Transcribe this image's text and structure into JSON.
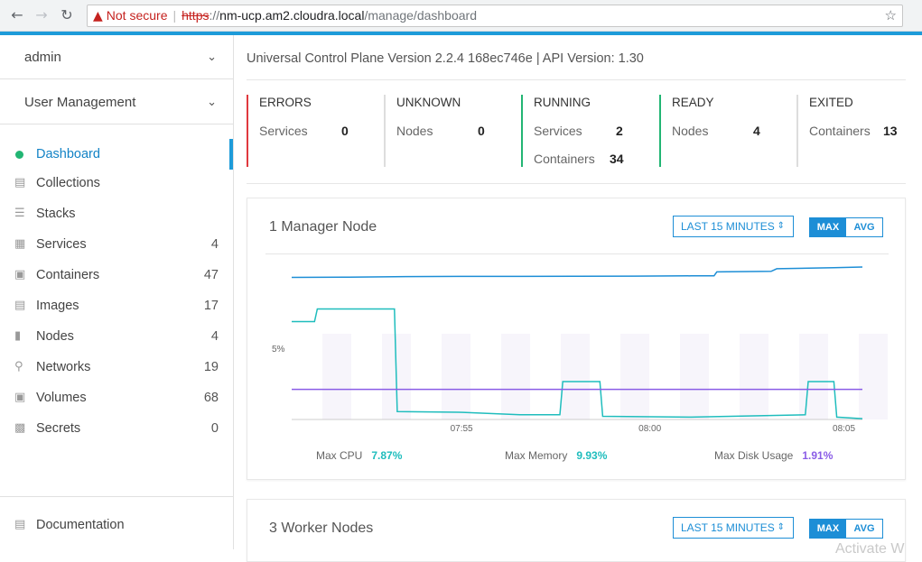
{
  "browser": {
    "warning_icon": "warning-triangle-icon",
    "security_label": "Not secure",
    "url_scheme": "https",
    "url_host": "nm-ucp.am2.cloudra.local",
    "url_path": "/manage/dashboard"
  },
  "sidebar": {
    "user": "admin",
    "section": "User Management",
    "items": [
      {
        "label": "Dashboard",
        "count": "",
        "icon": "status-dot-icon"
      },
      {
        "label": "Collections",
        "count": "",
        "icon": "collections-icon"
      },
      {
        "label": "Stacks",
        "count": "",
        "icon": "stacks-icon"
      },
      {
        "label": "Services",
        "count": "4",
        "icon": "services-icon"
      },
      {
        "label": "Containers",
        "count": "47",
        "icon": "container-icon"
      },
      {
        "label": "Images",
        "count": "17",
        "icon": "image-icon"
      },
      {
        "label": "Nodes",
        "count": "4",
        "icon": "node-icon"
      },
      {
        "label": "Networks",
        "count": "19",
        "icon": "network-icon"
      },
      {
        "label": "Volumes",
        "count": "68",
        "icon": "volume-icon"
      },
      {
        "label": "Secrets",
        "count": "0",
        "icon": "lock-icon"
      }
    ],
    "documentation": "Documentation"
  },
  "header": {
    "version_text": "Universal Control Plane Version 2.2.4 168ec746e | API Version: 1.30"
  },
  "stats": {
    "errors": {
      "title": "ERRORS",
      "rows": [
        {
          "label": "Services",
          "value": "0"
        }
      ],
      "color": "#e0393e"
    },
    "unknown": {
      "title": "UNKNOWN",
      "rows": [
        {
          "label": "Nodes",
          "value": "0"
        }
      ],
      "color": "#dddddd"
    },
    "running": {
      "title": "RUNNING",
      "rows": [
        {
          "label": "Services",
          "value": "2"
        },
        {
          "label": "Containers",
          "value": "34"
        }
      ],
      "color": "#22b573"
    },
    "ready": {
      "title": "READY",
      "rows": [
        {
          "label": "Nodes",
          "value": "4"
        }
      ],
      "color": "#22b573"
    },
    "exited": {
      "title": "EXITED",
      "rows": [
        {
          "label": "Containers",
          "value": "13"
        }
      ],
      "color": "#dddddd"
    }
  },
  "manager_panel": {
    "title": "1 Manager Node",
    "range": "LAST 15 MINUTES",
    "max": "MAX",
    "avg": "AVG",
    "legend": [
      {
        "label": "Max CPU",
        "value": "7.87%",
        "color": "#1fbdbd"
      },
      {
        "label": "Max Memory",
        "value": "9.93%",
        "color": "#1fbdbd"
      },
      {
        "label": "Max Disk Usage",
        "value": "1.91%",
        "color": "#8a5ce6"
      }
    ]
  },
  "worker_panel": {
    "title": "3 Worker Nodes",
    "range": "LAST 15 MINUTES",
    "max": "MAX",
    "avg": "AVG"
  },
  "watermark": "Activate W",
  "chart_data": {
    "type": "line",
    "y_tick_label": "5%",
    "x_tick_labels": [
      "07:55",
      "08:00",
      "08:05"
    ],
    "series": [
      {
        "name": "Max Memory",
        "color": "#1d8ed6",
        "points": [
          [
            0,
            9.0
          ],
          [
            0.1,
            9.02
          ],
          [
            0.2,
            9.05
          ],
          [
            0.3,
            9.06
          ],
          [
            0.4,
            9.06
          ],
          [
            0.5,
            9.07
          ],
          [
            0.6,
            9.08
          ],
          [
            0.7,
            9.1
          ],
          [
            0.74,
            9.1
          ],
          [
            0.745,
            9.35
          ],
          [
            0.84,
            9.38
          ],
          [
            0.85,
            9.55
          ],
          [
            0.95,
            9.62
          ],
          [
            1.0,
            9.66
          ]
        ]
      },
      {
        "name": "Max CPU",
        "color": "#1fbdbd",
        "points": [
          [
            0,
            6.2
          ],
          [
            0.04,
            6.2
          ],
          [
            0.045,
            7.0
          ],
          [
            0.18,
            7.0
          ],
          [
            0.185,
            0.5
          ],
          [
            0.3,
            0.45
          ],
          [
            0.4,
            0.3
          ],
          [
            0.47,
            0.3
          ],
          [
            0.475,
            2.4
          ],
          [
            0.54,
            2.4
          ],
          [
            0.545,
            0.2
          ],
          [
            0.7,
            0.15
          ],
          [
            0.9,
            0.3
          ],
          [
            0.905,
            2.4
          ],
          [
            0.95,
            2.4
          ],
          [
            0.955,
            0.15
          ],
          [
            1.0,
            0.05
          ]
        ]
      },
      {
        "name": "Max Disk Usage",
        "color": "#8a5ce6",
        "points": [
          [
            0,
            1.91
          ],
          [
            1.0,
            1.91
          ]
        ]
      }
    ]
  }
}
